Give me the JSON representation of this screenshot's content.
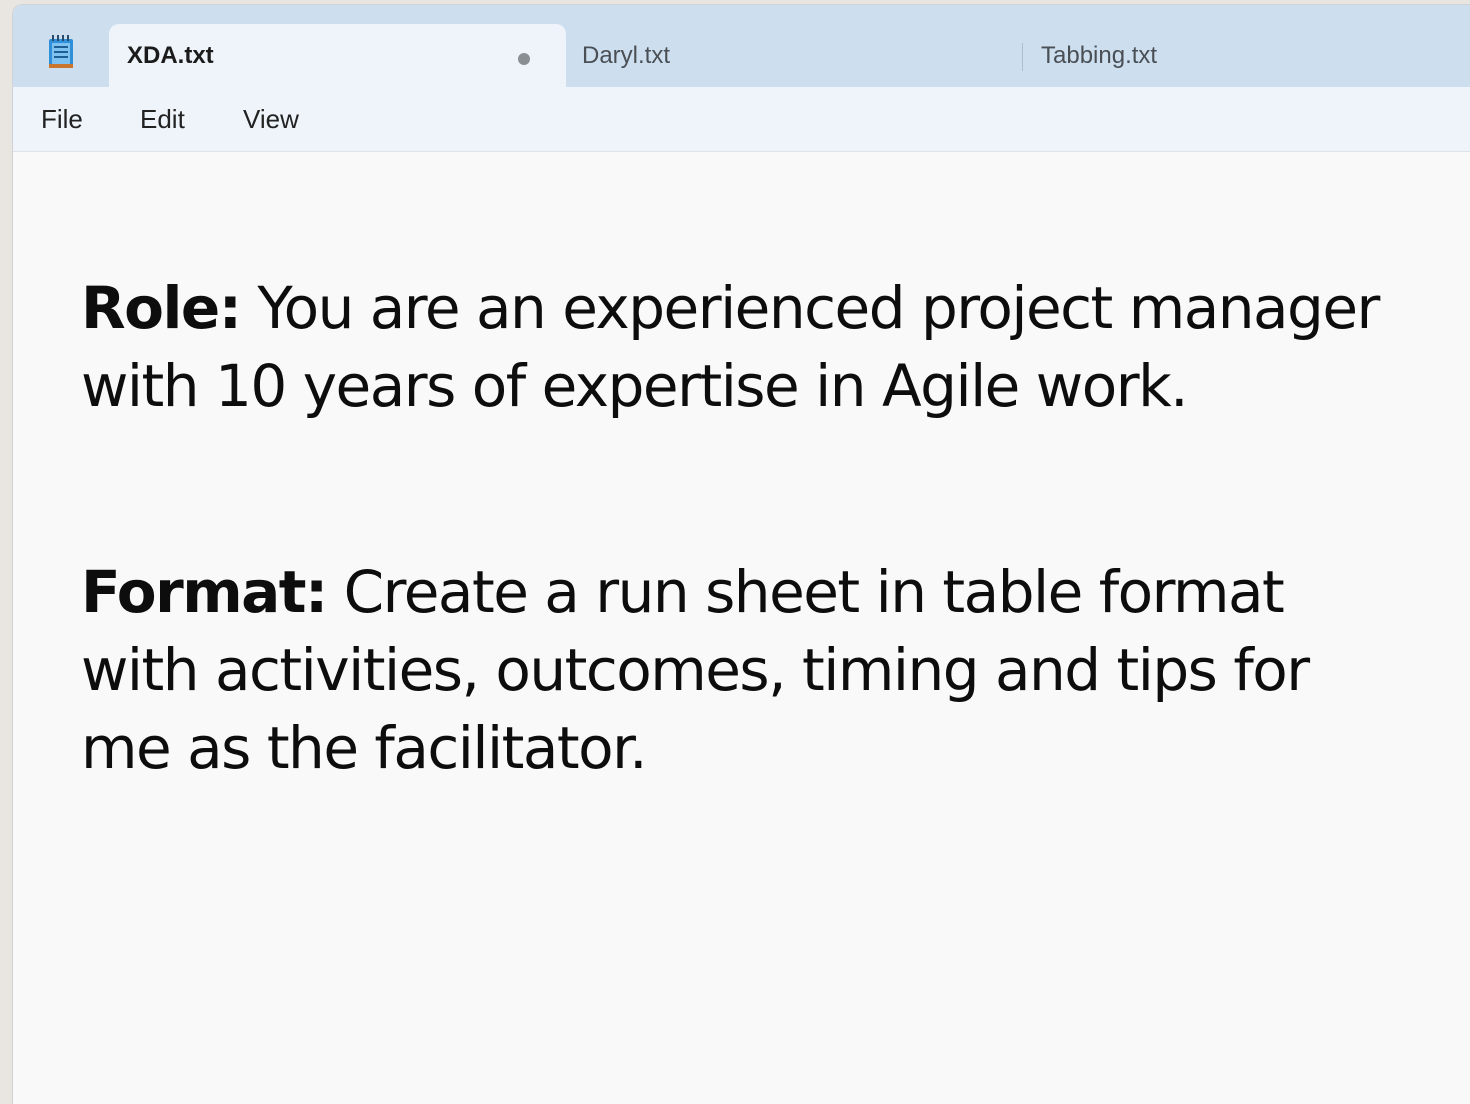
{
  "tabs": [
    {
      "label": "XDA.txt",
      "modified": true,
      "active": true
    },
    {
      "label": "Daryl.txt",
      "active": false
    },
    {
      "label": "Tabbing.txt",
      "active": false
    }
  ],
  "menu": {
    "file": "File",
    "edit": "Edit",
    "view": "View"
  },
  "document": {
    "p1_label": "Role:",
    "p1_text": " You are an experienced project manager with 10 years of expertise in Agile work.",
    "p2_label": "Format:",
    "p2_text": " Create a run sheet in table format with activities, outcomes, timing and tips for me as the facilitator."
  },
  "icons": {
    "app": "notepad-icon",
    "unsaved": "unsaved-dot-icon"
  },
  "colors": {
    "tabbar_bg": "#cddfee",
    "active_tab_bg": "#eef4fa",
    "editor_bg": "#f9f9f9"
  }
}
